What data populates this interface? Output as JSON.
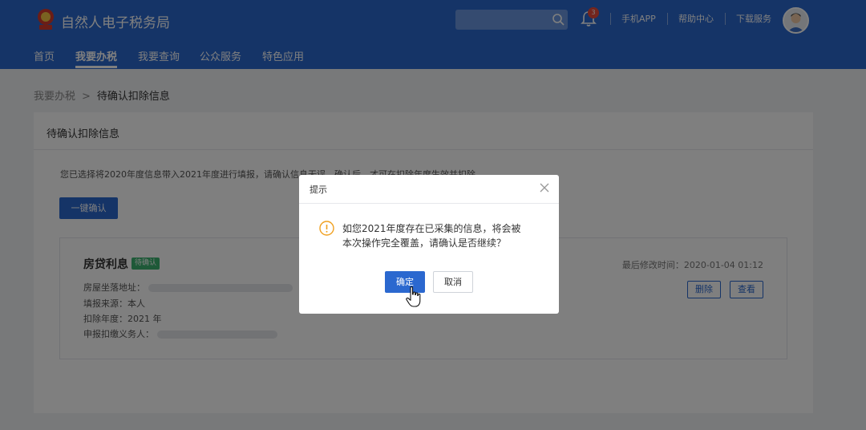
{
  "header": {
    "app_title": "自然人电子税务局",
    "search": {
      "placeholder": ""
    },
    "notification_count": "3",
    "links": [
      "手机APP",
      "帮助中心",
      "下载服务"
    ]
  },
  "nav": {
    "items": [
      "首页",
      "我要办税",
      "我要查询",
      "公众服务",
      "特色应用"
    ],
    "active": "我要办税"
  },
  "breadcrumb": {
    "parent": "我要办税",
    "separator": ">",
    "current": "待确认扣除信息"
  },
  "panel": {
    "title": "待确认扣除信息",
    "notice": "您已选择将2020年度信息带入2021年度进行填报，请确认信息无误，确认后，才可在扣除年度生效并扣除。",
    "confirm_all_button": "一键确认"
  },
  "card": {
    "title": "房贷利息",
    "status": "待确认",
    "fields": [
      {
        "label": "房屋坐落地址：",
        "value": ""
      },
      {
        "label": "填报来源：",
        "value": "本人"
      },
      {
        "label": "扣除年度：",
        "value": "2021 年"
      },
      {
        "label": "申报扣缴义务人：",
        "value": ""
      }
    ],
    "modified_label": "最后修改时间：",
    "modified_time": "2020-01-04 01:12",
    "delete_button": "删除",
    "view_button": "查看"
  },
  "dialog": {
    "title": "提示",
    "message_line1": "如您2021年度存在已采集的信息，将会被",
    "message_line2": "本次操作完全覆盖，请确认是否继续？",
    "ok_button": "确定",
    "cancel_button": "取消"
  },
  "colors": {
    "primary": "#2b68cf",
    "status_green": "#3cb371",
    "warning_orange": "#f0a020",
    "badge_red": "#e64a3c"
  }
}
